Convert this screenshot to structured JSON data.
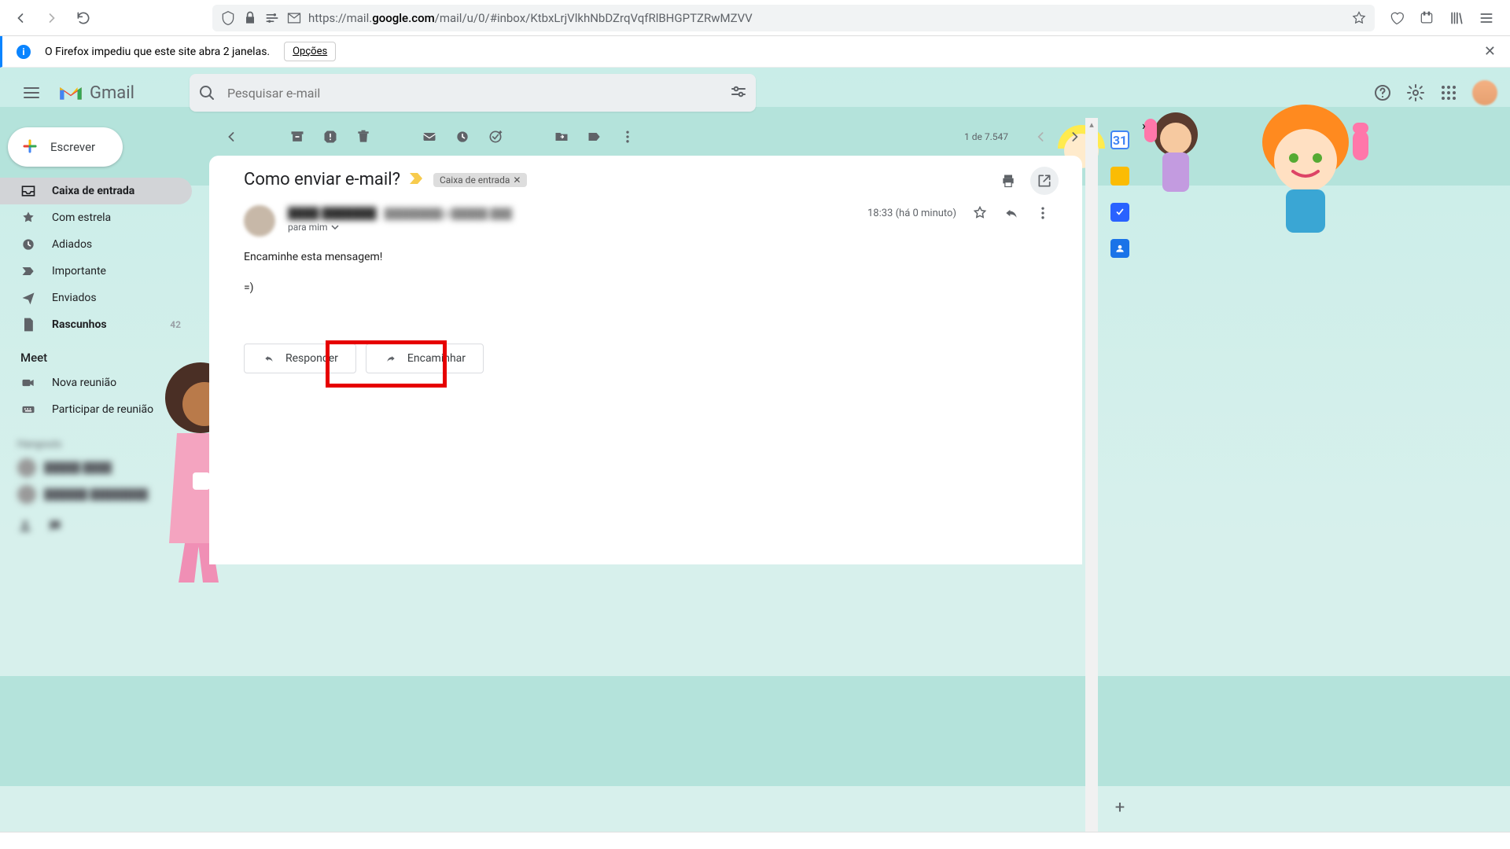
{
  "browser": {
    "url_prefix": "https://mail.",
    "url_domain": "google.com",
    "url_path": "/mail/u/0/#inbox/KtbxLrjVlkhNbDZrqVqfRlBHGPTZRwMZVV"
  },
  "infobar": {
    "message": "O Firefox impediu que este site abra 2 janelas.",
    "options_label": "Opções"
  },
  "header": {
    "product": "Gmail",
    "search_placeholder": "Pesquisar e-mail"
  },
  "compose_label": "Escrever",
  "sidebar": {
    "items": [
      {
        "label": "Caixa de entrada",
        "active": true,
        "bold": true
      },
      {
        "label": "Com estrela"
      },
      {
        "label": "Adiados"
      },
      {
        "label": "Importante"
      },
      {
        "label": "Enviados"
      },
      {
        "label": "Rascunhos",
        "bold": true,
        "count": "42"
      }
    ],
    "meet_label": "Meet",
    "meet_items": [
      {
        "label": "Nova reunião"
      },
      {
        "label": "Participar de reunião"
      }
    ]
  },
  "toolbar": {
    "page_indicator": "1 de 7.547"
  },
  "message": {
    "subject": "Como enviar e-mail?",
    "chip_label": "Caixa de entrada",
    "to_line": "para mim",
    "timestamp": "18:33 (há 0 minuto)",
    "body_line1": "Encaminhe esta mensagem!",
    "body_line2": "=)",
    "reply_label": "Responder",
    "forward_label": "Encaminhar"
  },
  "sidepanel": {
    "calendar_day": "31"
  }
}
